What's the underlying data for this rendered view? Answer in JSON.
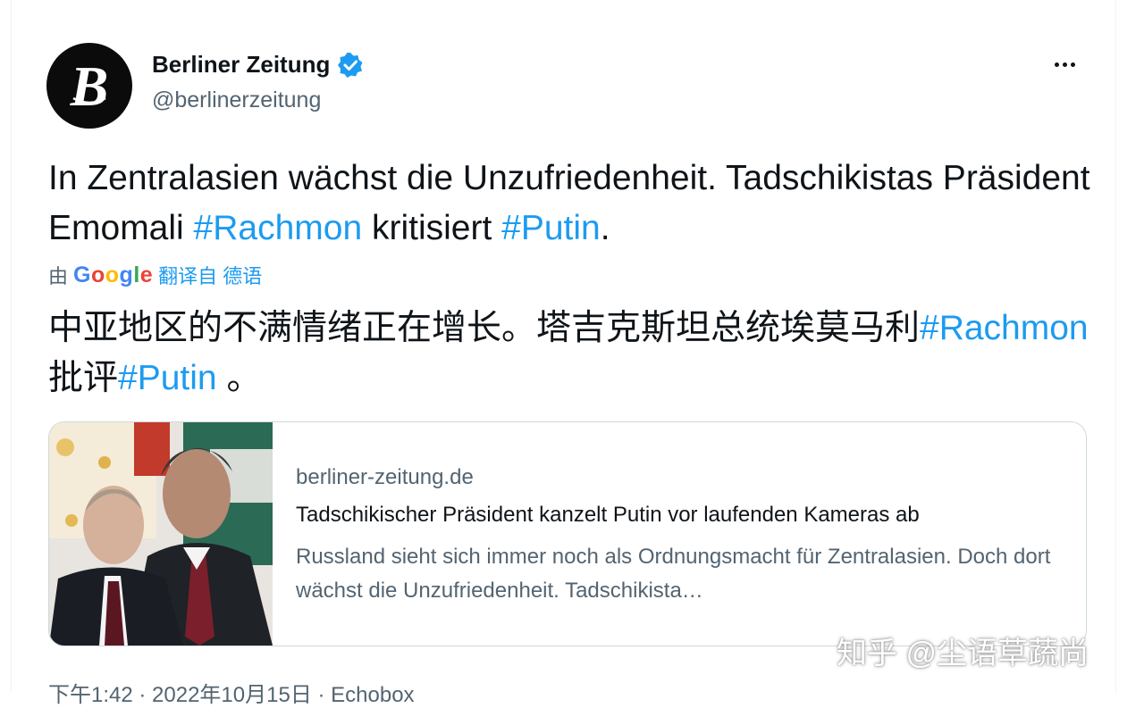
{
  "account": {
    "name": "Berliner Zeitung",
    "handle": "@berlinerzeitung",
    "avatar_letter": "B",
    "verified": true
  },
  "tweet": {
    "text_part1": "In Zentralasien wächst die Unzufriedenheit. Tadschikistas Präsident Emomali ",
    "hashtag1": "#Rachmon",
    "text_part2": " kritisiert ",
    "hashtag2": "#Putin",
    "text_part3": "."
  },
  "translation": {
    "by": "由",
    "google_letters": [
      "G",
      "o",
      "o",
      "g",
      "l",
      "e"
    ],
    "link_label": "翻译自 德语",
    "text_part1": "中亚地区的不满情绪正在增长。塔吉克斯坦总统埃莫马利",
    "hashtag1": "#Rachmon",
    "text_part2": "批评",
    "hashtag2": "#Putin",
    "text_part3": " 。"
  },
  "card": {
    "domain": "berliner-zeitung.de",
    "title": "Tadschikischer Präsident kanzelt Putin vor laufenden Kameras ab",
    "description": "Russland sieht sich immer noch als Ordnungsmacht für Zentralasien. Doch dort wächst die Unzufriedenheit. Tadschikista…"
  },
  "meta": {
    "text": "下午1:42 · 2022年10月15日 · Echobox"
  },
  "watermark": "知乎 @尘语草蔬尚",
  "colors": {
    "link": "#1d9bf0",
    "verified": "#1d9bf0",
    "secondary_text": "#536471"
  },
  "icons": {
    "verified": "verified-badge-icon",
    "more": "more-dots-icon"
  }
}
